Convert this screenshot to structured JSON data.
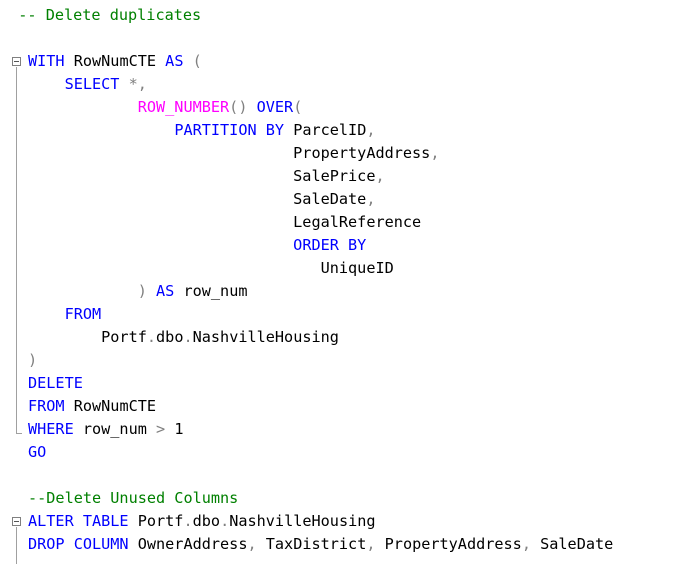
{
  "editor": {
    "lines": [
      {
        "tokens": [
          {
            "text": "  -- Delete duplicates",
            "cls": "cm"
          }
        ]
      },
      {
        "tokens": []
      },
      {
        "tokens": [
          {
            "text": "WITH",
            "cls": "kw"
          },
          {
            "text": " RowNumCTE ",
            "cls": "plain"
          },
          {
            "text": "AS",
            "cls": "kw"
          },
          {
            "text": " (",
            "cls": "op"
          }
        ]
      },
      {
        "tokens": [
          {
            "text": "    ",
            "cls": "plain"
          },
          {
            "text": "SELECT",
            "cls": "kw"
          },
          {
            "text": " *,",
            "cls": "op"
          }
        ]
      },
      {
        "tokens": [
          {
            "text": "            ",
            "cls": "plain"
          },
          {
            "text": "ROW_NUMBER",
            "cls": "fn"
          },
          {
            "text": "() ",
            "cls": "op"
          },
          {
            "text": "OVER",
            "cls": "kw"
          },
          {
            "text": "(",
            "cls": "op"
          }
        ]
      },
      {
        "tokens": [
          {
            "text": "                ",
            "cls": "plain"
          },
          {
            "text": "PARTITION BY",
            "cls": "kw"
          },
          {
            "text": " ParcelID",
            "cls": "plain"
          },
          {
            "text": ",",
            "cls": "op"
          }
        ]
      },
      {
        "tokens": [
          {
            "text": "                             PropertyAddress",
            "cls": "plain"
          },
          {
            "text": ",",
            "cls": "op"
          }
        ]
      },
      {
        "tokens": [
          {
            "text": "                             SalePrice",
            "cls": "plain"
          },
          {
            "text": ",",
            "cls": "op"
          }
        ]
      },
      {
        "tokens": [
          {
            "text": "                             SaleDate",
            "cls": "plain"
          },
          {
            "text": ",",
            "cls": "op"
          }
        ]
      },
      {
        "tokens": [
          {
            "text": "                             LegalReference",
            "cls": "plain"
          }
        ]
      },
      {
        "tokens": [
          {
            "text": "                             ",
            "cls": "plain"
          },
          {
            "text": "ORDER BY",
            "cls": "kw"
          }
        ]
      },
      {
        "tokens": [
          {
            "text": "                                UniqueID",
            "cls": "plain"
          }
        ]
      },
      {
        "tokens": [
          {
            "text": "            ",
            "cls": "plain"
          },
          {
            "text": ") ",
            "cls": "op"
          },
          {
            "text": "AS",
            "cls": "kw"
          },
          {
            "text": " row_num",
            "cls": "plain"
          }
        ]
      },
      {
        "tokens": [
          {
            "text": "    ",
            "cls": "plain"
          },
          {
            "text": "FROM",
            "cls": "kw"
          }
        ]
      },
      {
        "tokens": [
          {
            "text": "        Portf",
            "cls": "plain"
          },
          {
            "text": ".",
            "cls": "op"
          },
          {
            "text": "dbo",
            "cls": "plain"
          },
          {
            "text": ".",
            "cls": "op"
          },
          {
            "text": "NashvilleHousing",
            "cls": "plain"
          }
        ]
      },
      {
        "tokens": [
          {
            "text": ")",
            "cls": "op"
          }
        ]
      },
      {
        "tokens": [
          {
            "text": "DELETE",
            "cls": "kw"
          }
        ]
      },
      {
        "tokens": [
          {
            "text": "FROM",
            "cls": "kw"
          },
          {
            "text": " RowNumCTE",
            "cls": "plain"
          }
        ]
      },
      {
        "tokens": [
          {
            "text": "WHERE",
            "cls": "kw"
          },
          {
            "text": " row_num ",
            "cls": "plain"
          },
          {
            "text": ">",
            "cls": "op"
          },
          {
            "text": " 1",
            "cls": "plain"
          }
        ]
      },
      {
        "tokens": [
          {
            "text": "GO",
            "cls": "kw"
          }
        ]
      },
      {
        "tokens": []
      },
      {
        "tokens": [
          {
            "text": "--Delete Unused Columns",
            "cls": "cm"
          }
        ]
      },
      {
        "tokens": [
          {
            "text": "ALTER TABLE",
            "cls": "kw"
          },
          {
            "text": " Portf",
            "cls": "plain"
          },
          {
            "text": ".",
            "cls": "op"
          },
          {
            "text": "dbo",
            "cls": "plain"
          },
          {
            "text": ".",
            "cls": "op"
          },
          {
            "text": "NashvilleHousing",
            "cls": "plain"
          }
        ]
      },
      {
        "tokens": [
          {
            "text": "DROP COLUMN",
            "cls": "kw"
          },
          {
            "text": " OwnerAddress",
            "cls": "plain"
          },
          {
            "text": ",",
            "cls": "op"
          },
          {
            "text": " TaxDistrict",
            "cls": "plain"
          },
          {
            "text": ",",
            "cls": "op"
          },
          {
            "text": " PropertyAddress",
            "cls": "plain"
          },
          {
            "text": ",",
            "cls": "op"
          },
          {
            "text": " SaleDate",
            "cls": "plain"
          }
        ]
      }
    ]
  },
  "colors": {
    "keyword": "#0000ff",
    "function": "#ff00ff",
    "comment": "#008000",
    "operator": "#808080",
    "text": "#000000"
  },
  "icons": {
    "fold_toggle": "collapse-minus-icon"
  }
}
